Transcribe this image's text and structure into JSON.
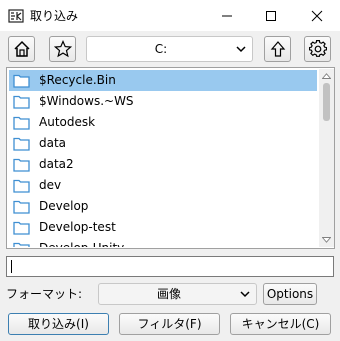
{
  "window": {
    "title": "取り込み",
    "app_icon": "app-logo-icon",
    "controls": [
      "minimize-icon",
      "maximize-icon",
      "close-icon"
    ]
  },
  "toolbar": {
    "home_icon": "home-icon",
    "favorites_icon": "star-icon",
    "path": "C:",
    "up_icon": "up-arrow-icon",
    "settings_icon": "gear-icon"
  },
  "files": {
    "items": [
      {
        "label": "$Recycle.Bin",
        "selected": true
      },
      {
        "label": "$Windows.~WS",
        "selected": false
      },
      {
        "label": "Autodesk",
        "selected": false
      },
      {
        "label": "data",
        "selected": false
      },
      {
        "label": "data2",
        "selected": false
      },
      {
        "label": "dev",
        "selected": false
      },
      {
        "label": "Develop",
        "selected": false
      },
      {
        "label": "Develop-test",
        "selected": false
      },
      {
        "label": "Develop-Unity",
        "selected": false
      }
    ]
  },
  "filename": {
    "value": ""
  },
  "format": {
    "label": "フォーマット:",
    "selected": "画像",
    "options_label": "Options"
  },
  "buttons": {
    "import": "取り込み(I)",
    "filter": "フィルタ(F)",
    "cancel": "キャンセル(C)"
  },
  "colors": {
    "selection": "#99c9ef",
    "folder": "#3f8fd2",
    "default_button_border": "#3c7fb1"
  }
}
